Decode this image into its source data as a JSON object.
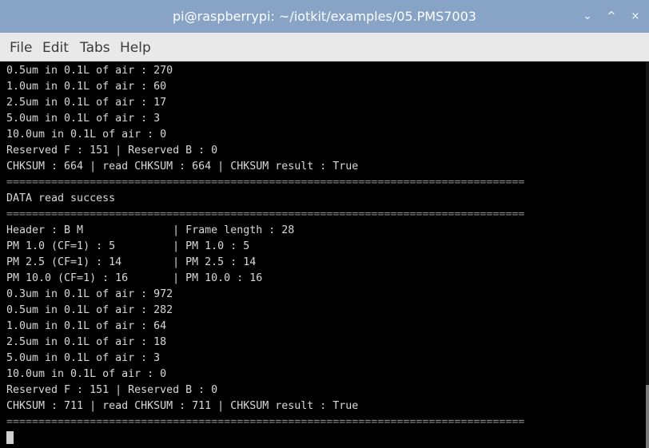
{
  "window": {
    "title": "pi@raspberrypi: ~/iotkit/examples/05.PMS7003",
    "minimize_glyph": "⌄",
    "maximize_glyph": "^",
    "close_glyph": "×"
  },
  "menu": [
    "File",
    "Edit",
    "Tabs",
    "Help"
  ],
  "terminal": {
    "lines": [
      "0.5um in 0.1L of air : 270",
      "1.0um in 0.1L of air : 60",
      "2.5um in 0.1L of air : 17",
      "5.0um in 0.1L of air : 3",
      "10.0um in 0.1L of air : 0",
      "Reserved F : 151 | Reserved B : 0",
      "CHKSUM : 664 | read CHKSUM : 664 | CHKSUM result : True",
      "=================================================================================",
      "DATA read success",
      "=================================================================================",
      "Header : B M              | Frame length : 28",
      "PM 1.0 (CF=1) : 5         | PM 1.0 : 5",
      "PM 2.5 (CF=1) : 14        | PM 2.5 : 14",
      "PM 10.0 (CF=1) : 16       | PM 10.0 : 16",
      "0.3um in 0.1L of air : 972",
      "0.5um in 0.1L of air : 282",
      "1.0um in 0.1L of air : 64",
      "2.5um in 0.1L of air : 18",
      "5.0um in 0.1L of air : 3",
      "10.0um in 0.1L of air : 0",
      "Reserved F : 151 | Reserved B : 0",
      "CHKSUM : 711 | read CHKSUM : 711 | CHKSUM result : True",
      "================================================================================="
    ]
  }
}
